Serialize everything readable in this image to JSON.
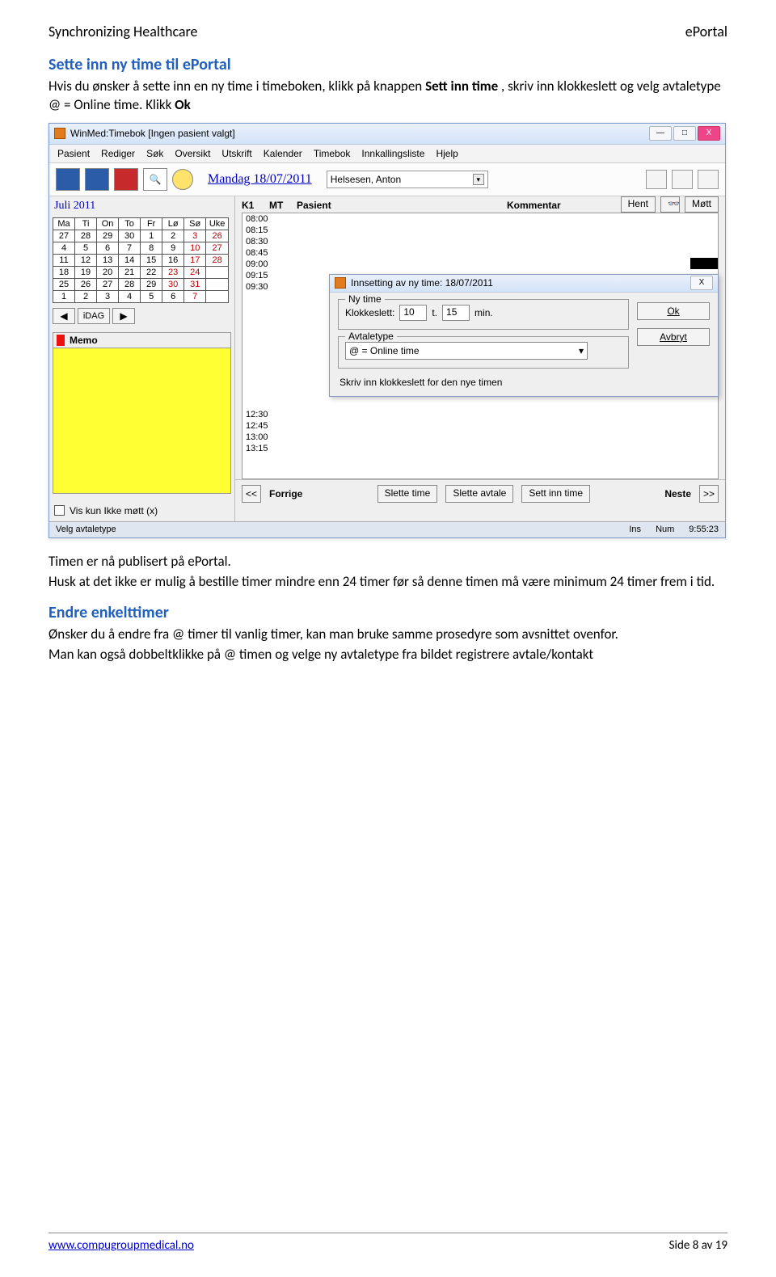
{
  "header": {
    "left": "Synchronizing Healthcare",
    "right": "ePortal"
  },
  "section1": {
    "title": "Sette inn ny time til ePortal",
    "p1a": "Hvis du ønsker å sette inn en ny time i timeboken, klikk på knappen ",
    "btn1": "Sett inn time",
    "p1b": ", skriv inn klokkeslett og velg avtaletype @ = Online time. Klikk ",
    "btn2": "Ok"
  },
  "win": {
    "title": "WinMed:Timebok [Ingen pasient valgt]",
    "winctrls": {
      "min": "—",
      "max": "□",
      "close": "X"
    },
    "menu": [
      "Pasient",
      "Rediger",
      "Søk",
      "Oversikt",
      "Utskrift",
      "Kalender",
      "Timebok",
      "Innkallingsliste",
      "Hjelp"
    ],
    "date": "Mandag 18/07/2011",
    "doctor": "Helsesen, Anton",
    "month": "Juli 2011",
    "cal_head": [
      "Ma",
      "Ti",
      "On",
      "To",
      "Fr",
      "Lø",
      "Sø",
      "Uke"
    ],
    "cal_rows": [
      [
        "27",
        "28",
        "29",
        "30",
        "1",
        "2",
        "3",
        "26"
      ],
      [
        "4",
        "5",
        "6",
        "7",
        "8",
        "9",
        "10",
        "27"
      ],
      [
        "11",
        "12",
        "13",
        "14",
        "15",
        "16",
        "17",
        "28"
      ],
      [
        "18",
        "19",
        "20",
        "21",
        "22",
        "23",
        "24",
        ""
      ],
      [
        "25",
        "26",
        "27",
        "28",
        "29",
        "30",
        "31",
        ""
      ],
      [
        "1",
        "2",
        "3",
        "4",
        "5",
        "6",
        "7",
        ""
      ]
    ],
    "nav": {
      "prev": "◀",
      "idag": "iDAG",
      "next": "▶"
    },
    "memo_title": "Memo",
    "chk_label": "Vis kun Ikke møtt (x)",
    "cols": {
      "k1": "K1",
      "mt": "MT",
      "pat": "Pasient",
      "kom": "Kommentar"
    },
    "hent": "Hent",
    "mott": "Møtt",
    "times_top": [
      "08:00",
      "08:15",
      "08:30",
      "08:45",
      "09:00",
      "09:15",
      "09:30"
    ],
    "times_bottom": [
      "12:30",
      "12:45",
      "13:00",
      "13:15"
    ],
    "bottom": {
      "forrige": "Forrige",
      "slette_time": "Slette time",
      "slette_avtale": "Slette avtale",
      "sett_inn": "Sett inn time",
      "neste": "Neste",
      "ll": "<<",
      "rr": ">>"
    },
    "status": {
      "left": "Velg avtaletype",
      "ins": "Ins",
      "num": "Num",
      "time": "9:55:23"
    }
  },
  "dlg": {
    "title": "Innsetting av ny time: 18/07/2011",
    "grp_time": "Ny time",
    "klokkeslett": "Klokkeslett:",
    "hour": "10",
    "t": "t.",
    "min_v": "15",
    "min_l": "min.",
    "grp_type": "Avtaletype",
    "type_val": "@ = Online time",
    "hint": "Skriv inn klokkeslett for den nye timen",
    "ok": "Ok",
    "avbryt": "Avbryt",
    "close": "X"
  },
  "after": {
    "l1": "Timen er nå publisert på ePortal.",
    "l2": "Husk at det ikke er mulig å bestille timer mindre enn 24 timer før så denne timen må være minimum 24 timer frem i tid."
  },
  "section2": {
    "title": "Endre enkelttimer",
    "p1": "Ønsker du å endre fra @ timer til vanlig timer, kan man bruke samme prosedyre som avsnittet ovenfor.",
    "p2": "Man kan også dobbeltklikke på @ timen og velge ny avtaletype fra bildet registrere avtale/kontakt"
  },
  "footer": {
    "url": "www.compugroupmedical.no",
    "page": "Side 8 av 19"
  }
}
